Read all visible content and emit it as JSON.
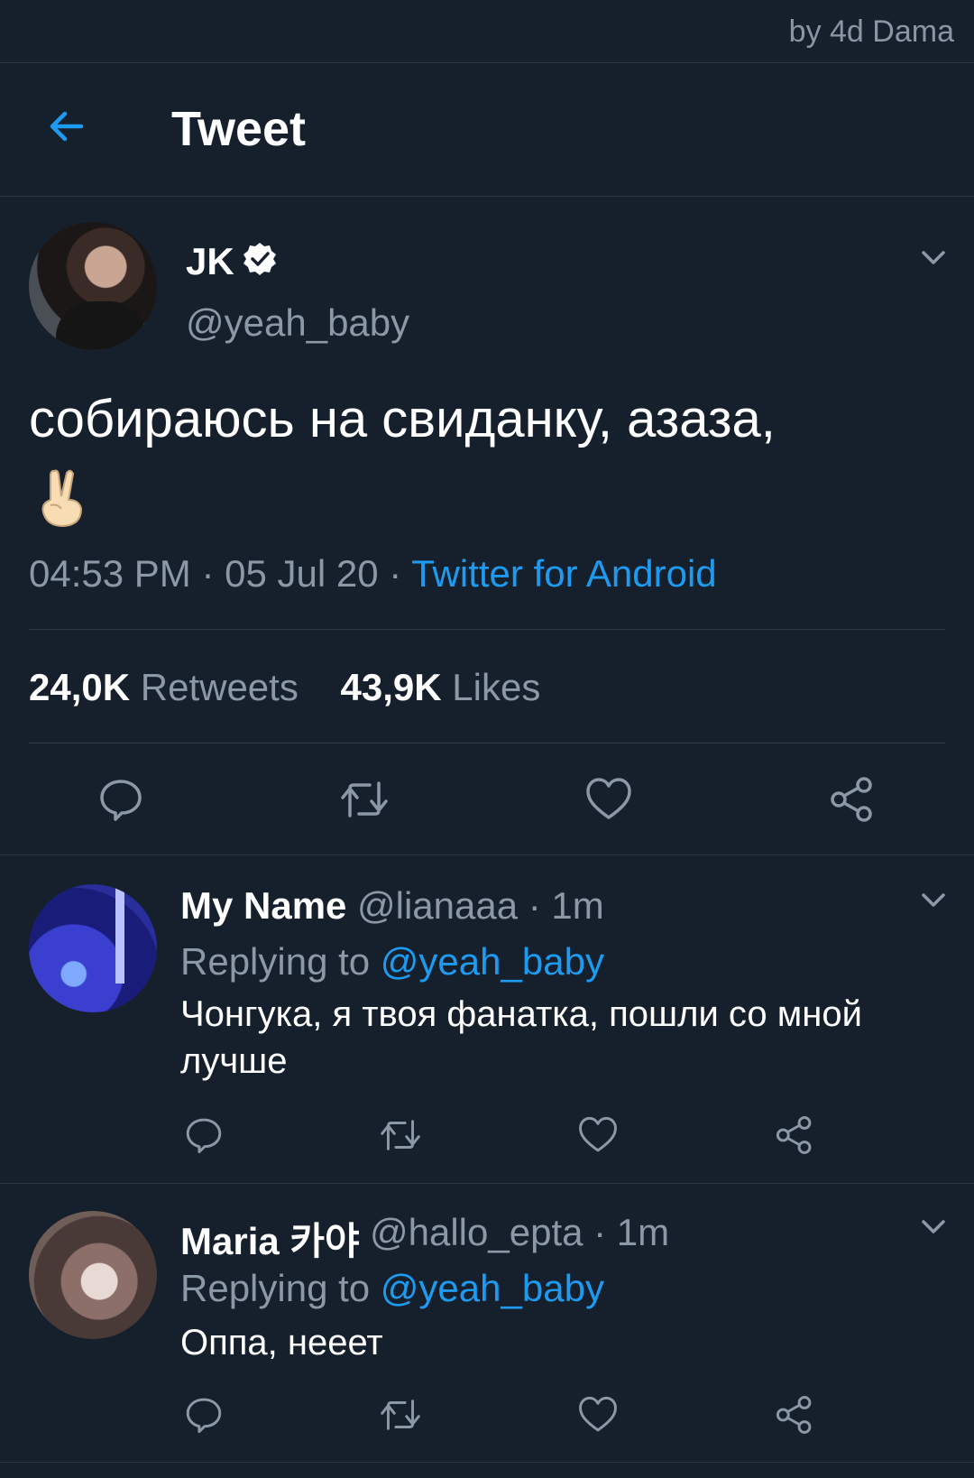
{
  "watermark": "by 4d Dama",
  "header": {
    "title": "Tweet"
  },
  "tweet": {
    "author_name": "JK",
    "author_handle": "@yeah_baby",
    "text": "собираюсь на свиданку, азаза,",
    "time": "04:53 PM",
    "date": "05 Jul 20",
    "sep": "·",
    "source": "Twitter for Android",
    "retweets_count": "24,0K",
    "retweets_label": "Retweets",
    "likes_count": "43,9K",
    "likes_label": "Likes"
  },
  "replies": [
    {
      "name": "My Name",
      "handle": "@lianaaa · 1m",
      "replying_label": "Replying to",
      "replying_to": "@yeah_baby",
      "text": "Чонгука, я твоя фанатка, пошли со мной лучше"
    },
    {
      "name": "Maria 카야",
      "handle": "@hallo_epta · 1m",
      "replying_label": "Replying to",
      "replying_to": "@yeah_baby",
      "text": "Оппа, нееет"
    }
  ],
  "colors": {
    "background": "#16202c",
    "accent": "#1d9bf0",
    "muted": "#8b98a5"
  }
}
